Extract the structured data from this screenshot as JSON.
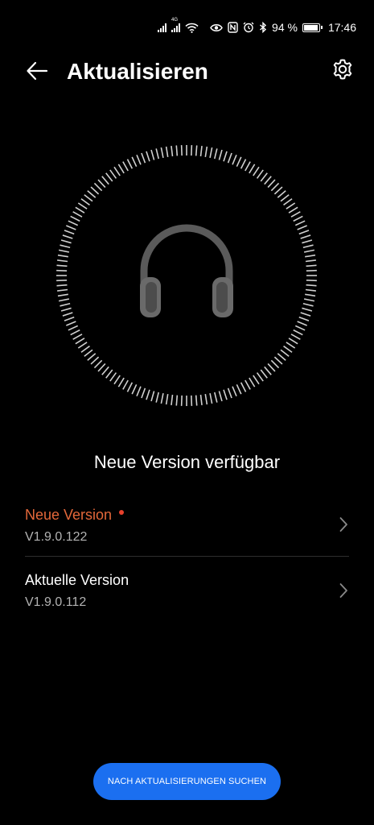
{
  "status_bar": {
    "battery": "94 %",
    "time": "17:46",
    "network_label": "4G",
    "icons": [
      "signal-icon",
      "signal-icon",
      "wifi-icon",
      "eye-icon",
      "nfc-icon",
      "alarm-icon",
      "bluetooth-icon",
      "battery-icon"
    ]
  },
  "header": {
    "title": "Aktualisieren",
    "back_icon": "arrow-left-icon",
    "settings_icon": "gear-icon"
  },
  "device": {
    "icon": "headphones-icon"
  },
  "main": {
    "heading": "Neue Version verfügbar",
    "versions": [
      {
        "title": "Neue Version",
        "version": "V1.9.0.122",
        "highlight": true
      },
      {
        "title": "Aktuelle Version",
        "version": "V1.9.0.112",
        "highlight": false
      }
    ]
  },
  "action": {
    "label": "NACH AKTUALISIERUNGEN SUCHEN"
  },
  "colors": {
    "background": "#000000",
    "accent_orange": "#e4683a",
    "badge_red": "#e8412c",
    "button_blue": "#1b6ff0",
    "secondary_text": "#b3b3b3"
  }
}
